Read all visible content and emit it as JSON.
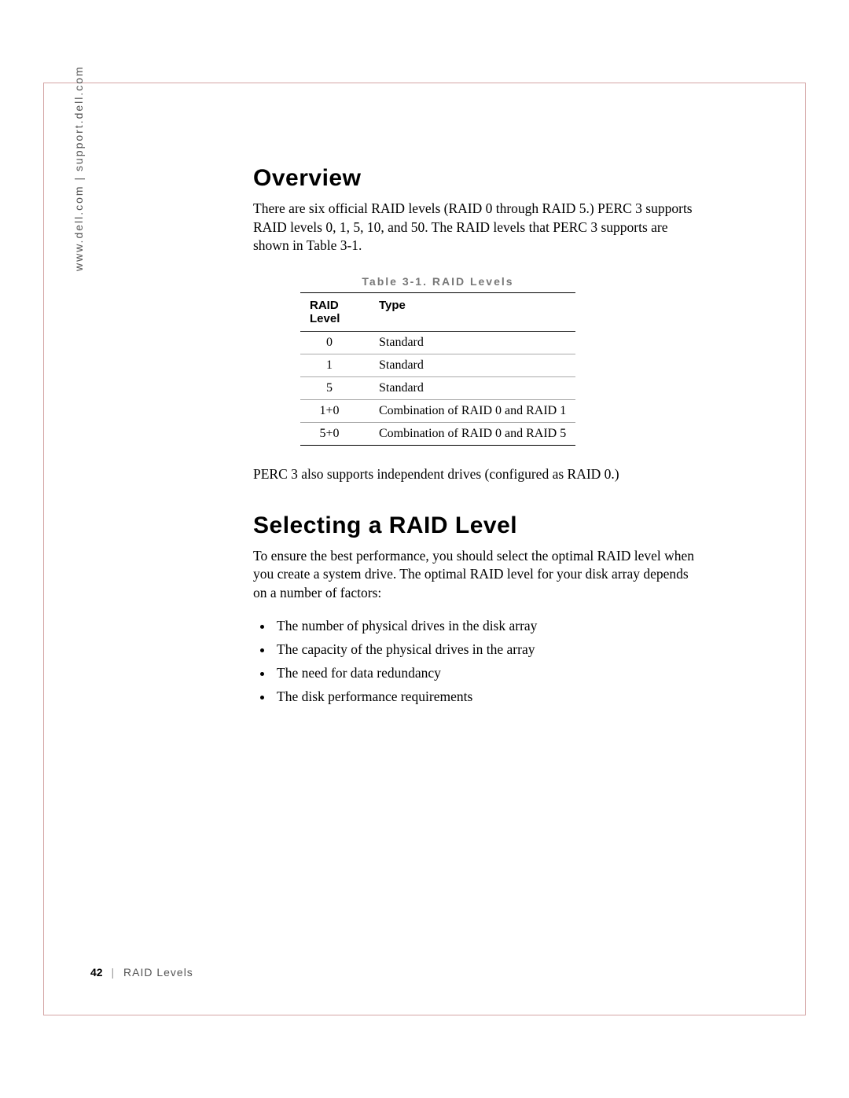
{
  "side_label": "www.dell.com | support.dell.com",
  "overview": {
    "heading": "Overview",
    "paragraph": "There are six official RAID levels (RAID 0 through RAID 5.) PERC 3 supports RAID levels 0, 1, 5, 10, and 50. The RAID levels that PERC 3 supports are shown in Table 3-1.",
    "after_table": "PERC 3 also supports independent drives (configured as RAID 0.)"
  },
  "table": {
    "caption": "Table 3-1. RAID Levels",
    "headers": {
      "col1a": "RAID",
      "col1b": "Level",
      "col2": "Type"
    },
    "rows": [
      {
        "level": "0",
        "type": "Standard"
      },
      {
        "level": "1",
        "type": "Standard"
      },
      {
        "level": "5",
        "type": "Standard"
      },
      {
        "level": "1+0",
        "type": "Combination of RAID 0 and RAID 1"
      },
      {
        "level": "5+0",
        "type": "Combination of RAID 0 and RAID 5"
      }
    ]
  },
  "selecting": {
    "heading": "Selecting a RAID Level",
    "paragraph": "To ensure the best performance, you should select the optimal RAID level when you create a system drive. The optimal RAID level for your disk array depends on a number of factors:",
    "factors": [
      "The number of physical drives in the disk array",
      "The capacity of the physical drives in the array",
      "The need for data redundancy",
      "The disk performance requirements"
    ]
  },
  "footer": {
    "page_number": "42",
    "separator": "|",
    "chapter": "RAID Levels"
  }
}
